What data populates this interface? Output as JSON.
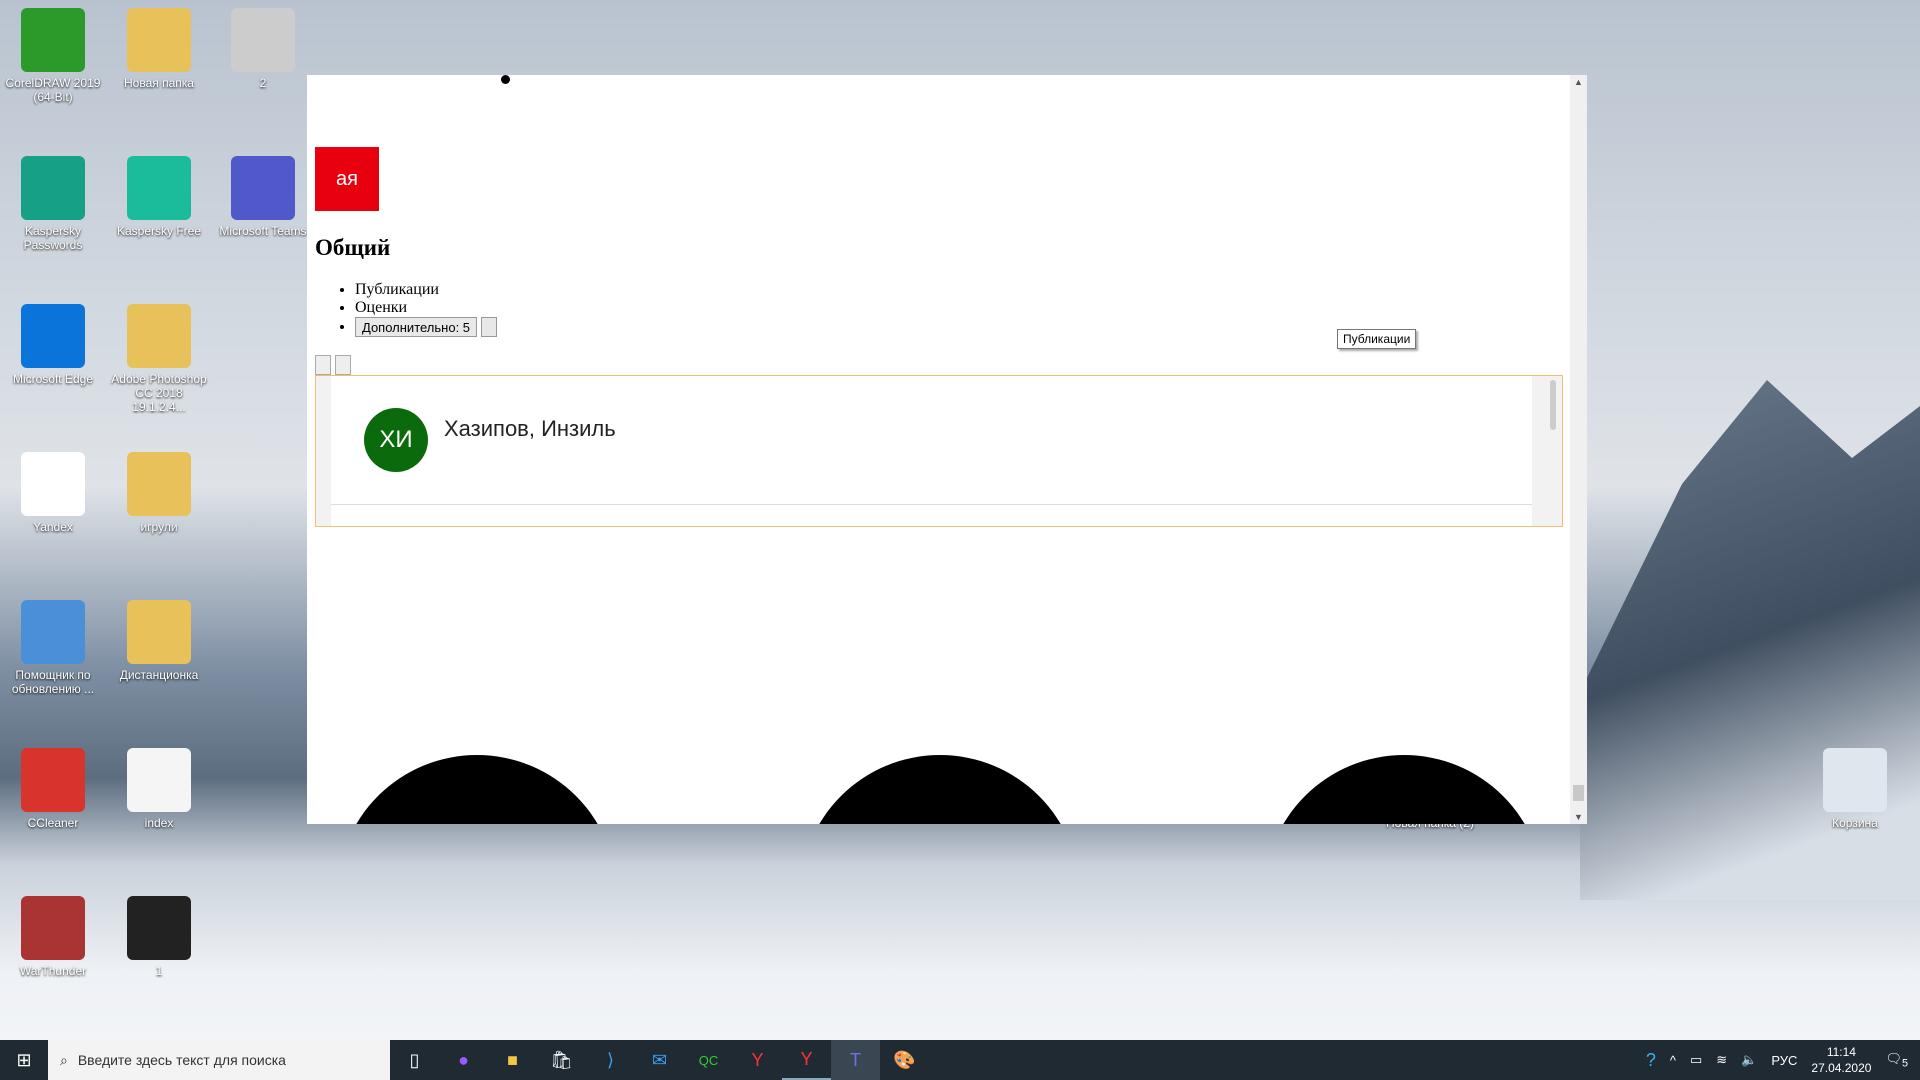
{
  "desktop": {
    "icons": [
      {
        "label": "CorelDRAW 2019 (64-Bit)",
        "color": "#2b9a2b"
      },
      {
        "label": "Новая папка",
        "color": "#e8c15a"
      },
      {
        "label": "2",
        "color": "#cccccc"
      },
      {
        "label": "Kaspersky Passwords",
        "color": "#16a085"
      },
      {
        "label": "Kaspersky Free",
        "color": "#1abc9c"
      },
      {
        "label": "Microsoft Teams",
        "color": "#5059c9"
      },
      {
        "label": "Microsoft Edge",
        "color": "#0a74da"
      },
      {
        "label": "Adobe Photoshop CC 2018 19.1.2.4...",
        "color": "#e8c15a"
      },
      {
        "label": "Yandex",
        "color": "#ffffff"
      },
      {
        "label": "игрули",
        "color": "#e8c15a"
      },
      {
        "label": "Помощник по обновлению ...",
        "color": "#4a90d9"
      },
      {
        "label": "Дистанционка",
        "color": "#e8c15a"
      },
      {
        "label": "CCleaner",
        "color": "#d9342b"
      },
      {
        "label": "index",
        "color": "#f5f5f5"
      },
      {
        "label": "WarThunder",
        "color": "#a33"
      },
      {
        "label": "1",
        "color": "#222222"
      },
      {
        "label": "Новая папка (2)",
        "color": "#e8c15a"
      },
      {
        "label": "Корзина",
        "color": "#dfe6ee"
      }
    ]
  },
  "window": {
    "tile_text": "ая",
    "tile_color": "#e8000f",
    "heading": "Общий",
    "list": [
      "Публикации",
      "Оценки"
    ],
    "more_button": "Дополнительно: 5",
    "tooltip": "Публикации",
    "card": {
      "initials": "ХИ",
      "name": "Хазипов, Инзиль",
      "avatar_color": "#0b6a0b"
    }
  },
  "taskbar": {
    "search_placeholder": "Введите здесь текст для поиска",
    "language": "РУС",
    "time": "11:14",
    "date": "27.04.2020",
    "notifications": "5"
  }
}
